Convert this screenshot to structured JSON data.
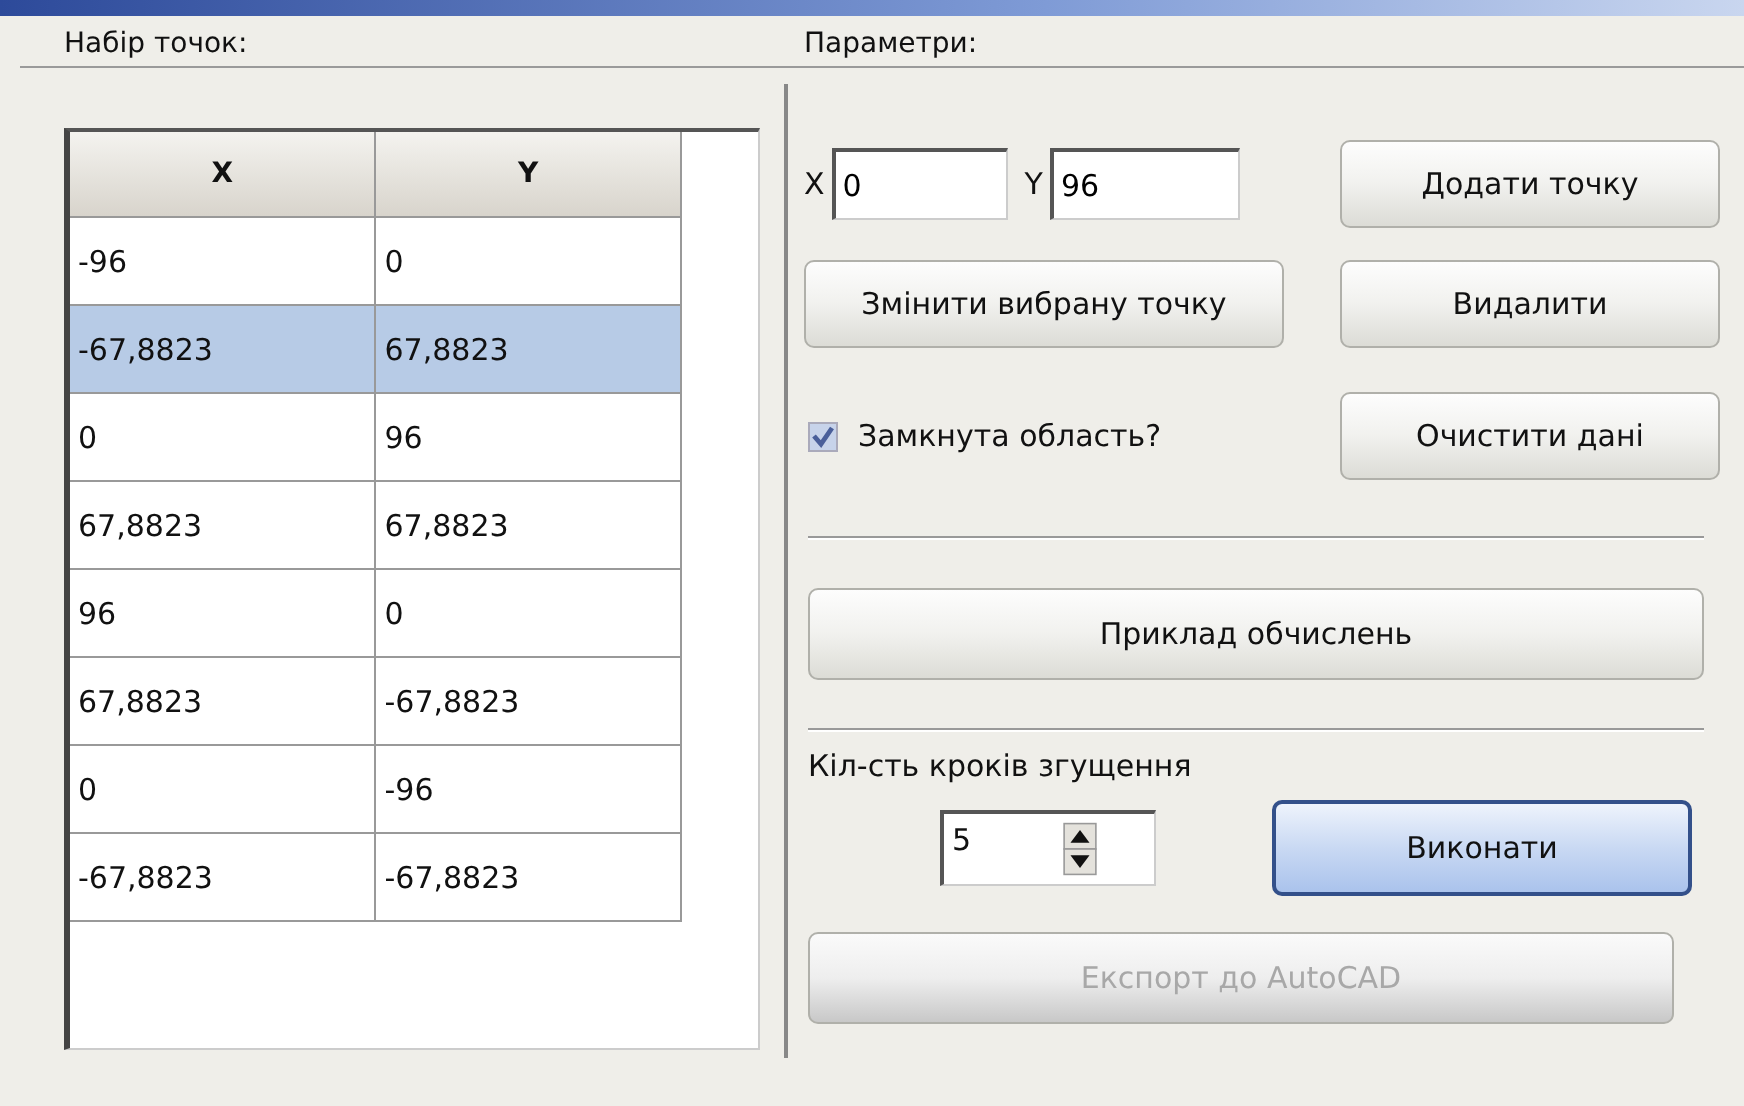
{
  "points_group": {
    "title": "Набір точок:",
    "table": {
      "columns": [
        "X",
        "Y"
      ],
      "rows": [
        {
          "cells": [
            "-96",
            "0"
          ],
          "selected": false
        },
        {
          "cells": [
            "-67,8823",
            "67,8823"
          ],
          "selected": true
        },
        {
          "cells": [
            "0",
            "96"
          ],
          "selected": false
        },
        {
          "cells": [
            "67,8823",
            "67,8823"
          ],
          "selected": false
        },
        {
          "cells": [
            "96",
            "0"
          ],
          "selected": false
        },
        {
          "cells": [
            "67,8823",
            "-67,8823"
          ],
          "selected": false
        },
        {
          "cells": [
            "0",
            "-96"
          ],
          "selected": false
        },
        {
          "cells": [
            "-67,8823",
            "-67,8823"
          ],
          "selected": false
        }
      ]
    }
  },
  "parameters_group": {
    "title": "Параметри:",
    "x_field": {
      "label": "X",
      "value": "0"
    },
    "y_field": {
      "label": "Y",
      "value": "96"
    },
    "add_button": "Додати точку",
    "edit_button": "Змінити вибрану точку",
    "delete_button": "Видалити",
    "closed_checkbox": {
      "label": "Замкнута область?",
      "checked": true
    },
    "clear_button": "Очистити дані",
    "example_button": "Приклад обчислень",
    "steps": {
      "label": "Кіл-сть кроків згущення",
      "value": "5"
    },
    "run_button": {
      "label": "Виконати",
      "focused": true
    },
    "export_button": {
      "label": "Експорт до AutoCAD",
      "disabled": true
    }
  }
}
